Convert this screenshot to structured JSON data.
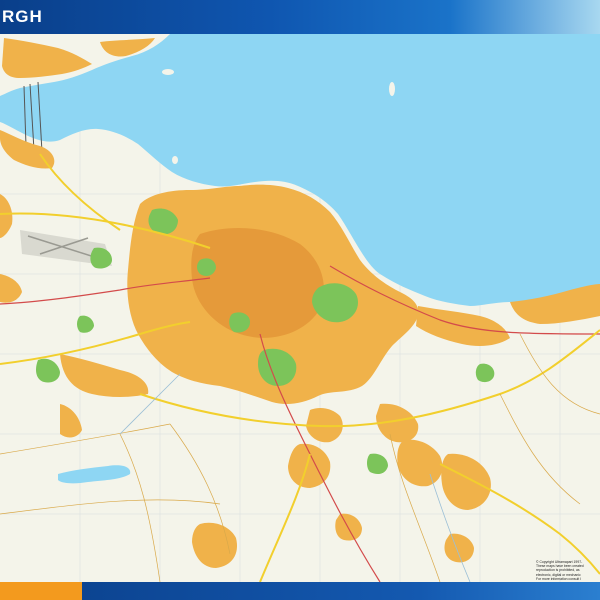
{
  "map": {
    "title": "RGH",
    "sea_label": "",
    "copyright_lines": [
      "© Copyright Ultramapart 1997-",
      "These maps have been created",
      "reproduction is prohibited, as",
      "electronic, digital or mechanic",
      "For more information consult l"
    ],
    "colors": {
      "sea": "#8ed6f3",
      "land": "#f4f4ea",
      "urban": "#f0b24a",
      "urban_dense": "#e59a3a",
      "park": "#7cc45a",
      "road_major": "#f2cf2d",
      "road_minor": "#ffffff",
      "rail": "#d34b4b",
      "boundary": "#b8c0c0",
      "header": "#0f56b0",
      "footer_accent": "#f39a1e"
    }
  }
}
